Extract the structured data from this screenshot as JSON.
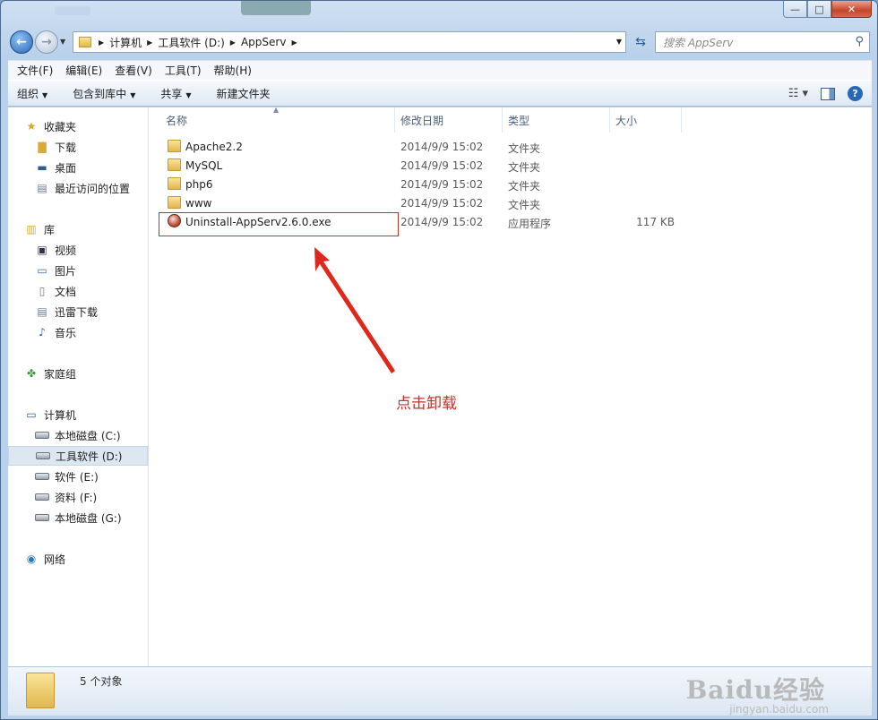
{
  "window": {
    "controls": {
      "minimize": "—",
      "maximize": "□",
      "close": "✕"
    }
  },
  "address": {
    "crumbs": [
      "计算机",
      "工具软件 (D:)",
      "AppServ"
    ],
    "search_placeholder": "搜索 AppServ"
  },
  "menubar": {
    "items": [
      "文件(F)",
      "编辑(E)",
      "查看(V)",
      "工具(T)",
      "帮助(H)"
    ]
  },
  "commandbar": {
    "organize": "组织",
    "include_in_library": "包含到库中",
    "share": "共享",
    "new_folder": "新建文件夹"
  },
  "navpane": {
    "favorites": "收藏夹",
    "downloads": "下载",
    "desktop": "桌面",
    "recent": "最近访问的位置",
    "libraries": "库",
    "videos": "视频",
    "pictures": "图片",
    "documents": "文档",
    "thunder": "迅雷下载",
    "music": "音乐",
    "homegroup": "家庭组",
    "computer": "计算机",
    "drive_c": "本地磁盘 (C:)",
    "drive_d": "工具软件 (D:)",
    "drive_e": "软件 (E:)",
    "drive_f": "资料 (F:)",
    "drive_g": "本地磁盘 (G:)",
    "network": "网络"
  },
  "columns": {
    "name": "名称",
    "modified": "修改日期",
    "type": "类型",
    "size": "大小"
  },
  "files": [
    {
      "name": "Apache2.2",
      "modified": "2014/9/9 15:02",
      "type": "文件夹",
      "size": ""
    },
    {
      "name": "MySQL",
      "modified": "2014/9/9 15:02",
      "type": "文件夹",
      "size": ""
    },
    {
      "name": "php6",
      "modified": "2014/9/9 15:02",
      "type": "文件夹",
      "size": ""
    },
    {
      "name": "www",
      "modified": "2014/9/9 15:02",
      "type": "文件夹",
      "size": ""
    },
    {
      "name": "Uninstall-AppServ2.6.0.exe",
      "modified": "2014/9/9 15:02",
      "type": "应用程序",
      "size": "117 KB"
    }
  ],
  "annotation": {
    "text": "点击卸载",
    "color": "#c8302a"
  },
  "status": {
    "count": "5 个对象"
  },
  "watermark": {
    "main": "Baidu经验",
    "sub": "jingyan.baidu.com"
  }
}
